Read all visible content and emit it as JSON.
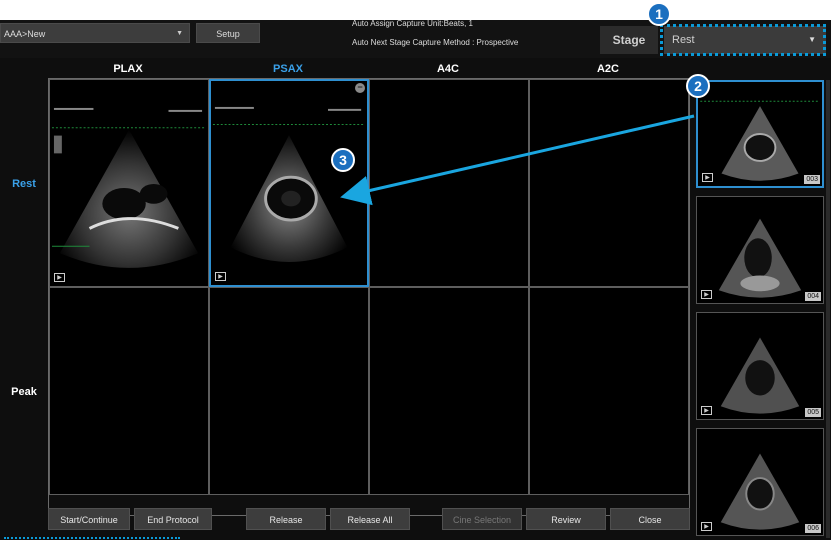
{
  "header": {
    "protocol_value": "AAA>New",
    "setup_label": "Setup",
    "info_line1": "Auto Assign Capture Unit:Beats, 1",
    "info_line2": "Auto Next Stage Capture Method : Prospective",
    "stage_label": "Stage",
    "stage_value": "Rest"
  },
  "columns": [
    "PLAX",
    "PSAX",
    "A4C",
    "A2C"
  ],
  "rows": [
    "Rest",
    "Peak"
  ],
  "colors": {
    "accent": "#2e8fd0",
    "selected_text": "#3aa0e8",
    "annotation": "#0a9ad8"
  },
  "thumbnails": [
    "003",
    "004",
    "005",
    "006"
  ],
  "buttons": {
    "start_continue": "Start/Continue",
    "end_protocol": "End Protocol",
    "release": "Release",
    "release_all": "Release All",
    "cine_selection": "Cine Selection",
    "review": "Review",
    "close": "Close"
  },
  "callouts": [
    "1",
    "2",
    "3"
  ]
}
